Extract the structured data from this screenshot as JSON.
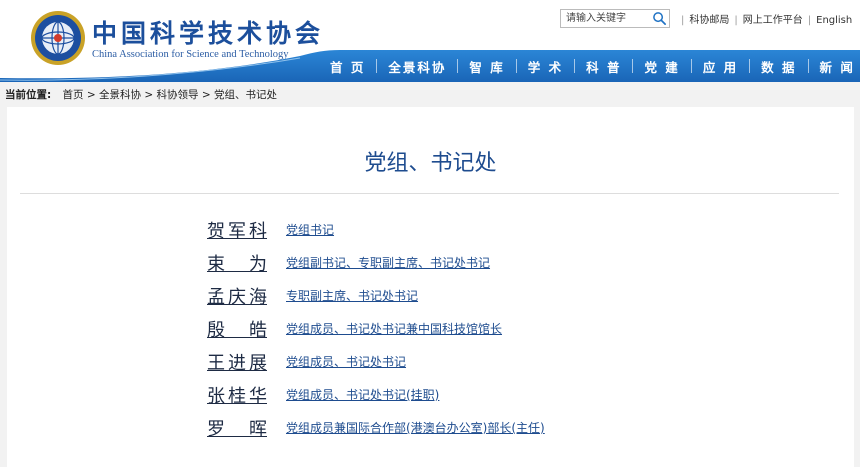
{
  "header": {
    "logo_cn": "中国科学技术协会",
    "logo_en": "China Association for Science and Technology",
    "search_placeholder": "请输入关键字",
    "links": [
      "科协邮局",
      "网上工作平台",
      "English"
    ],
    "nav": [
      "首 页",
      "全景科协",
      "智 库",
      "学 术",
      "科 普",
      "党 建",
      "应 用",
      "数 据",
      "新 闻"
    ]
  },
  "breadcrumb": {
    "label": "当前位置:",
    "items": [
      "首页",
      "全景科协",
      "科协领导",
      "党组、书记处"
    ],
    "separator": ">"
  },
  "page": {
    "title": "党组、书记处"
  },
  "people": [
    {
      "name": "贺军科",
      "role": "党组书记"
    },
    {
      "name": "束 为",
      "role": "党组副书记、专职副主席、书记处书记"
    },
    {
      "name": "孟庆海",
      "role": "专职副主席、书记处书记"
    },
    {
      "name": "殷 皓",
      "role": "党组成员、书记处书记兼中国科技馆馆长"
    },
    {
      "name": "王进展",
      "role": "党组成员、书记处书记"
    },
    {
      "name": "张桂华",
      "role": "党组成员、书记处书记(挂职)"
    },
    {
      "name": "罗 晖",
      "role": "党组成员兼国际合作部(港澳台办公室)部长(主任)"
    }
  ],
  "colors": {
    "nav_blue": "#1f72c4",
    "title_blue": "#1e4c8f",
    "page_bg": "#f2f2f2"
  }
}
